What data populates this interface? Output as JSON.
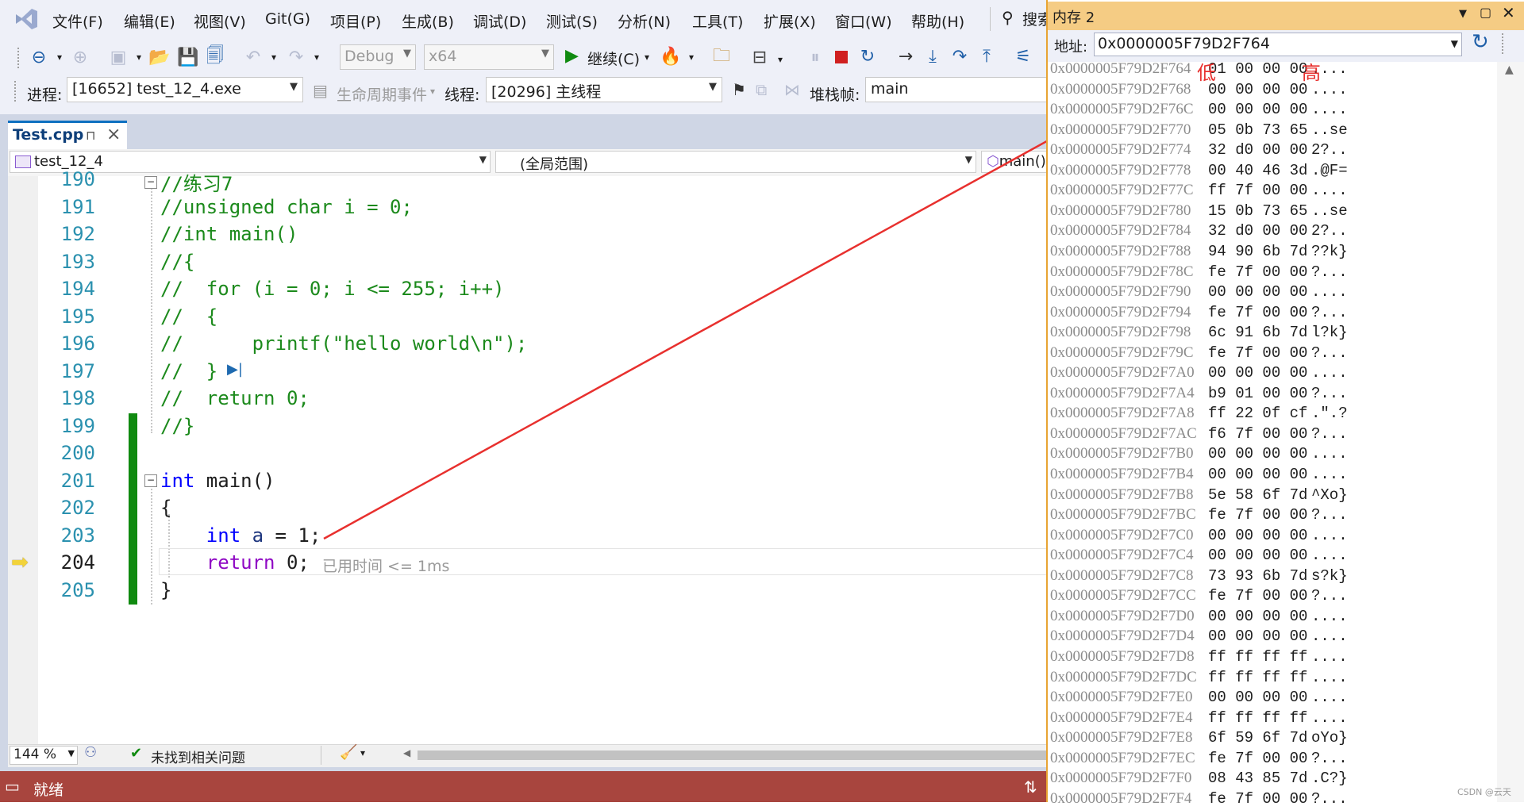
{
  "menu": [
    "文件(F)",
    "编辑(E)",
    "视图(V)",
    "Git(G)",
    "项目(P)",
    "生成(B)",
    "调试(D)",
    "测试(S)",
    "分析(N)",
    "工具(T)",
    "扩展(X)",
    "窗口(W)",
    "帮助(H)"
  ],
  "search_label": "搜索",
  "toolbar": {
    "config": "Debug",
    "platform": "x64",
    "continue_label": "继续(C)"
  },
  "locbar": {
    "process_label": "进程:",
    "process_value": "[16652] test_12_4.exe",
    "lifecycle_label": "生命周期事件",
    "thread_label": "线程:",
    "thread_value": "[20296] 主线程",
    "stack_label": "堆栈帧:",
    "stack_value": "main"
  },
  "tab": {
    "name": "Test.cpp",
    "pin": "ᵖ",
    "close": "×"
  },
  "nav": {
    "project": "test_12_4",
    "scope": "(全局范围)",
    "member": "main()"
  },
  "code_lines": [
    {
      "n": "190",
      "text": "//练习7"
    },
    {
      "n": "191",
      "text": "//unsigned char i = 0;"
    },
    {
      "n": "192",
      "text": "//int main()"
    },
    {
      "n": "193",
      "text": "//{"
    },
    {
      "n": "194",
      "text": "//  for (i = 0; i <= 255; i++)"
    },
    {
      "n": "195",
      "text": "//  {"
    },
    {
      "n": "196",
      "text": "//      printf(\"hello world\\n\");"
    },
    {
      "n": "197",
      "text": "//  }"
    },
    {
      "n": "198",
      "text": "//  return 0;"
    },
    {
      "n": "199",
      "text": "//}"
    },
    {
      "n": "200",
      "text": ""
    },
    {
      "n": "201",
      "text": "int main()"
    },
    {
      "n": "202",
      "text": "{"
    },
    {
      "n": "203",
      "text": "    int a = 1;"
    },
    {
      "n": "204",
      "text": "    return 0;"
    },
    {
      "n": "205",
      "text": "}"
    }
  ],
  "elapsed_hint": "已用时间 <= 1ms",
  "editstrip": {
    "zoom": "144 %",
    "issues": "未找到相关问题"
  },
  "status": {
    "ready": "就绪"
  },
  "memory": {
    "title": "内存 2",
    "addr_label": "地址:",
    "addr_value": "0x0000005F79D2F764",
    "low_label": "低",
    "high_label": "高",
    "rows": [
      {
        "addr": "0x0000005F79D2F764",
        "bytes": "01 00 00 00",
        "chars": "...."
      },
      {
        "addr": "0x0000005F79D2F768",
        "bytes": "00 00 00 00",
        "chars": "...."
      },
      {
        "addr": "0x0000005F79D2F76C",
        "bytes": "00 00 00 00",
        "chars": "...."
      },
      {
        "addr": "0x0000005F79D2F770",
        "bytes": "05 0b 73 65",
        "chars": "..se"
      },
      {
        "addr": "0x0000005F79D2F774",
        "bytes": "32 d0 00 00",
        "chars": "2?.."
      },
      {
        "addr": "0x0000005F79D2F778",
        "bytes": "00 40 46 3d",
        "chars": ".@F="
      },
      {
        "addr": "0x0000005F79D2F77C",
        "bytes": "ff 7f 00 00",
        "chars": "...."
      },
      {
        "addr": "0x0000005F79D2F780",
        "bytes": "15 0b 73 65",
        "chars": "..se"
      },
      {
        "addr": "0x0000005F79D2F784",
        "bytes": "32 d0 00 00",
        "chars": "2?.."
      },
      {
        "addr": "0x0000005F79D2F788",
        "bytes": "94 90 6b 7d",
        "chars": "??k}"
      },
      {
        "addr": "0x0000005F79D2F78C",
        "bytes": "fe 7f 00 00",
        "chars": "?..."
      },
      {
        "addr": "0x0000005F79D2F790",
        "bytes": "00 00 00 00",
        "chars": "...."
      },
      {
        "addr": "0x0000005F79D2F794",
        "bytes": "fe 7f 00 00",
        "chars": "?..."
      },
      {
        "addr": "0x0000005F79D2F798",
        "bytes": "6c 91 6b 7d",
        "chars": "l?k}"
      },
      {
        "addr": "0x0000005F79D2F79C",
        "bytes": "fe 7f 00 00",
        "chars": "?..."
      },
      {
        "addr": "0x0000005F79D2F7A0",
        "bytes": "00 00 00 00",
        "chars": "...."
      },
      {
        "addr": "0x0000005F79D2F7A4",
        "bytes": "b9 01 00 00",
        "chars": "?..."
      },
      {
        "addr": "0x0000005F79D2F7A8",
        "bytes": "ff 22 0f cf",
        "chars": ".\".?"
      },
      {
        "addr": "0x0000005F79D2F7AC",
        "bytes": "f6 7f 00 00",
        "chars": "?..."
      },
      {
        "addr": "0x0000005F79D2F7B0",
        "bytes": "00 00 00 00",
        "chars": "...."
      },
      {
        "addr": "0x0000005F79D2F7B4",
        "bytes": "00 00 00 00",
        "chars": "...."
      },
      {
        "addr": "0x0000005F79D2F7B8",
        "bytes": "5e 58 6f 7d",
        "chars": "^Xo}"
      },
      {
        "addr": "0x0000005F79D2F7BC",
        "bytes": "fe 7f 00 00",
        "chars": "?..."
      },
      {
        "addr": "0x0000005F79D2F7C0",
        "bytes": "00 00 00 00",
        "chars": "...."
      },
      {
        "addr": "0x0000005F79D2F7C4",
        "bytes": "00 00 00 00",
        "chars": "...."
      },
      {
        "addr": "0x0000005F79D2F7C8",
        "bytes": "73 93 6b 7d",
        "chars": "s?k}"
      },
      {
        "addr": "0x0000005F79D2F7CC",
        "bytes": "fe 7f 00 00",
        "chars": "?..."
      },
      {
        "addr": "0x0000005F79D2F7D0",
        "bytes": "00 00 00 00",
        "chars": "...."
      },
      {
        "addr": "0x0000005F79D2F7D4",
        "bytes": "00 00 00 00",
        "chars": "...."
      },
      {
        "addr": "0x0000005F79D2F7D8",
        "bytes": "ff ff ff ff",
        "chars": "...."
      },
      {
        "addr": "0x0000005F79D2F7DC",
        "bytes": "ff ff ff ff",
        "chars": "...."
      },
      {
        "addr": "0x0000005F79D2F7E0",
        "bytes": "00 00 00 00",
        "chars": "...."
      },
      {
        "addr": "0x0000005F79D2F7E4",
        "bytes": "ff ff ff ff",
        "chars": "...."
      },
      {
        "addr": "0x0000005F79D2F7E8",
        "bytes": "6f 59 6f 7d",
        "chars": "oYo}"
      },
      {
        "addr": "0x0000005F79D2F7EC",
        "bytes": "fe 7f 00 00",
        "chars": "?..."
      },
      {
        "addr": "0x0000005F79D2F7F0",
        "bytes": "08 43 85 7d",
        "chars": ".C?}"
      },
      {
        "addr": "0x0000005F79D2F7F4",
        "bytes": "fe 7f 00 00",
        "chars": "?..."
      }
    ]
  },
  "watermark": "CSDN @云天",
  "colors": {
    "accent": "#e8a433",
    "status_bg": "#a8453e",
    "arrow": "#e8302e",
    "green_bar": "#108a10"
  }
}
